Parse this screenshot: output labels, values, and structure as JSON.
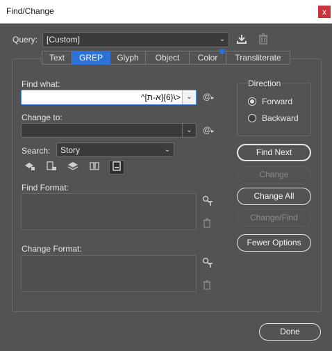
{
  "window": {
    "title": "Find/Change",
    "close_glyph": "x"
  },
  "query": {
    "label": "Query:",
    "value": "[Custom]",
    "save_icon": "save-query-icon",
    "delete_icon": "delete-query-icon"
  },
  "tabs": [
    {
      "label": "Text",
      "active": false
    },
    {
      "label": "GREP",
      "active": true
    },
    {
      "label": "Glyph",
      "active": false
    },
    {
      "label": "Object",
      "active": false
    },
    {
      "label": "Color",
      "active": false
    },
    {
      "label": "Transliterate",
      "active": false
    }
  ],
  "find": {
    "label": "Find what:",
    "value": "^[א-ת]{6}\\>"
  },
  "change": {
    "label": "Change to:",
    "value": ""
  },
  "search": {
    "label": "Search:",
    "value": "Story"
  },
  "find_format": {
    "label": "Find Format:"
  },
  "change_format": {
    "label": "Change Format:"
  },
  "direction": {
    "label": "Direction",
    "forward": "Forward",
    "backward": "Backward",
    "selected": "Forward"
  },
  "buttons": {
    "find_next": "Find Next",
    "change": "Change",
    "change_all": "Change All",
    "change_find": "Change/Find",
    "fewer_options": "Fewer Options",
    "done": "Done"
  },
  "colors": {
    "accent": "#2d72d9",
    "background": "#535353",
    "field": "#3b3b3b",
    "titlebar": "#ffffff",
    "close": "#c8343a"
  }
}
